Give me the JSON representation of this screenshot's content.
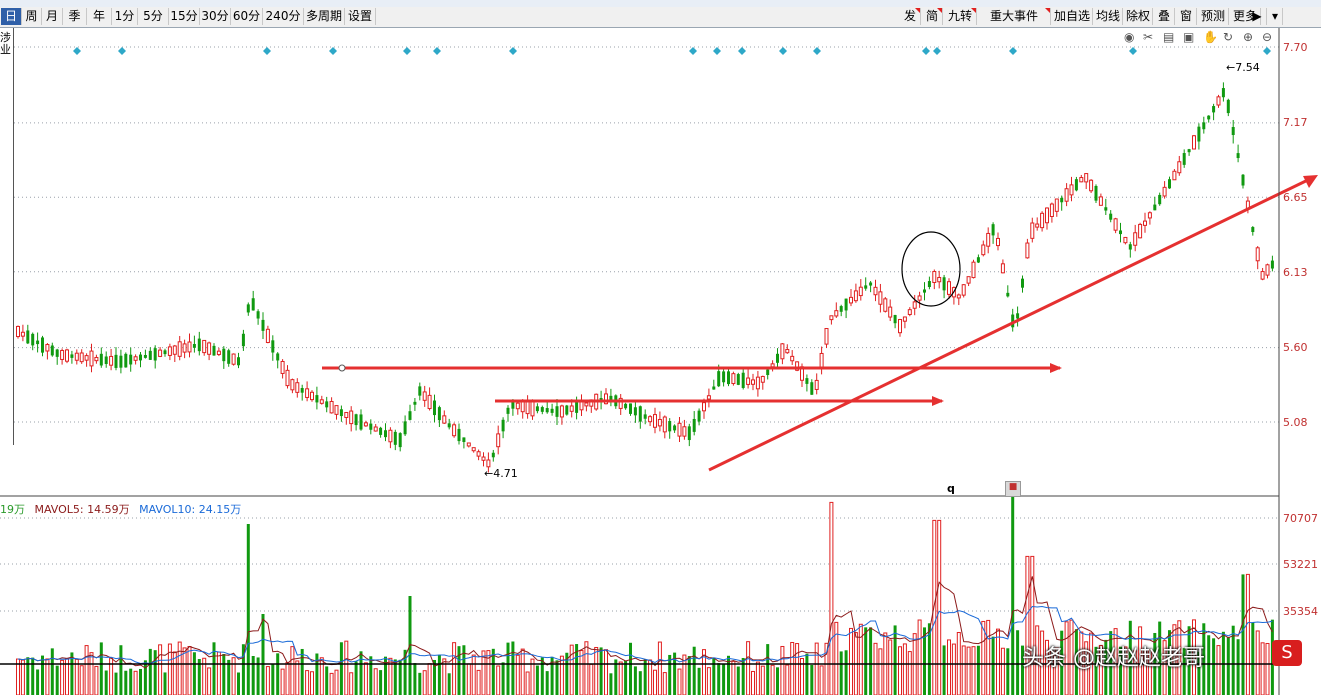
{
  "toolbar": {
    "left_items": [
      "日",
      "周",
      "月",
      "季",
      "年",
      "1分",
      "5分",
      "15分",
      "30分",
      "60分",
      "240分",
      "多周期",
      "设置"
    ],
    "active_item": "日",
    "right_items": [
      "发",
      "简",
      "九转",
      "重大事件",
      "加自选",
      "均线",
      "除权",
      "叠",
      "窗",
      "预测",
      "更多"
    ]
  },
  "left_panel": {
    "text": "涉业"
  },
  "price_axis": {
    "labels": [
      "7.70",
      "7.17",
      "6.65",
      "6.13",
      "5.60",
      "5.08"
    ],
    "values": [
      7.7,
      7.17,
      6.65,
      6.13,
      5.6,
      5.08
    ]
  },
  "chart_labels": {
    "high": "7.54",
    "low": "4.71",
    "marker_q": "q"
  },
  "volume_axis": {
    "labels": [
      "70707",
      "53221",
      "35354"
    ],
    "values": [
      70707,
      53221,
      35354
    ]
  },
  "volume_legend": {
    "vol": "19万",
    "mavol5": "MAVOL5: 14.59万",
    "mavol10": "MAVOL10: 24.15万"
  },
  "watermark": {
    "text": "头条 @赵赵赵老哥"
  },
  "colors": {
    "up": "#e02020",
    "down": "#109910",
    "ma5": "#8b1a1a",
    "ma10": "#1a6ad8",
    "grid": "#9aa0aa",
    "annotation": "#e53030"
  },
  "chart_data": {
    "type": "candlestick",
    "ylim": [
      4.5,
      7.78
    ],
    "annotations": {
      "high": 7.54,
      "low": 4.71,
      "horizontal_lines": [
        5.5,
        5.25
      ]
    }
  }
}
